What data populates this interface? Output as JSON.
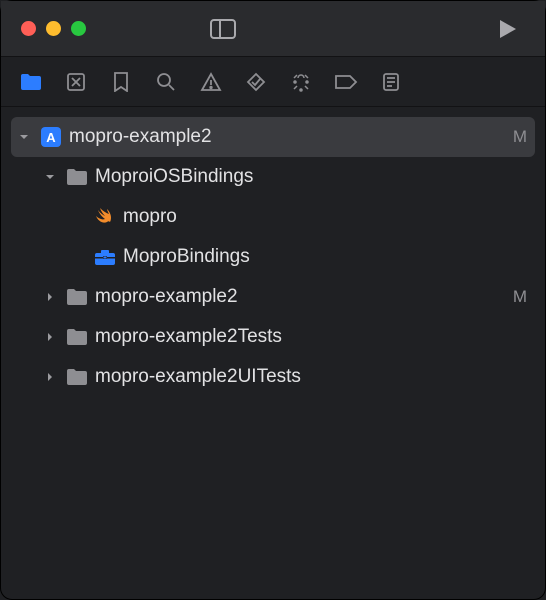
{
  "colors": {
    "close": "#ff5f57",
    "minimize": "#febc2e",
    "zoom": "#28c840",
    "accent": "#2c7dff",
    "swift": "#f28c2b",
    "folder": "#8e8e92",
    "toolbox": "#2c7dff",
    "app": "#2c7dff"
  },
  "project": {
    "name": "mopro-example2",
    "status": "M"
  },
  "tree": [
    {
      "label": "MoproiOSBindings",
      "icon": "folder",
      "expanded": true,
      "children": [
        {
          "label": "mopro",
          "icon": "swift"
        },
        {
          "label": "MoproBindings",
          "icon": "toolbox"
        }
      ]
    },
    {
      "label": "mopro-example2",
      "icon": "folder",
      "expanded": false,
      "status": "M"
    },
    {
      "label": "mopro-example2Tests",
      "icon": "folder",
      "expanded": false
    },
    {
      "label": "mopro-example2UITests",
      "icon": "folder",
      "expanded": false
    }
  ]
}
